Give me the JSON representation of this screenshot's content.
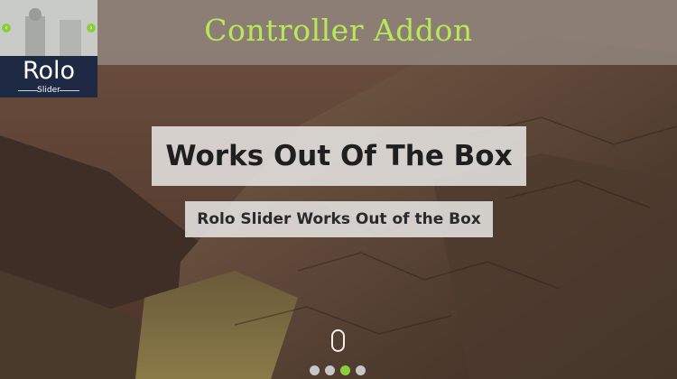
{
  "header": {
    "title": "Controller Addon",
    "title_color": "#b6e85a"
  },
  "thumbnail": {
    "prev_icon": "chevron-left-icon",
    "next_icon": "chevron-right-icon",
    "arrow_color": "#8ccf3e"
  },
  "logo": {
    "main": "Rolo",
    "sub": "Slider"
  },
  "slide": {
    "title": "Works Out Of The Box",
    "subtitle": "Rolo Slider Works Out of the Box"
  },
  "scroll_indicator": {
    "icon": "mouse-scroll-icon"
  },
  "pagination": {
    "count": 4,
    "active_index": 2,
    "active_color": "#8ccf3e"
  }
}
